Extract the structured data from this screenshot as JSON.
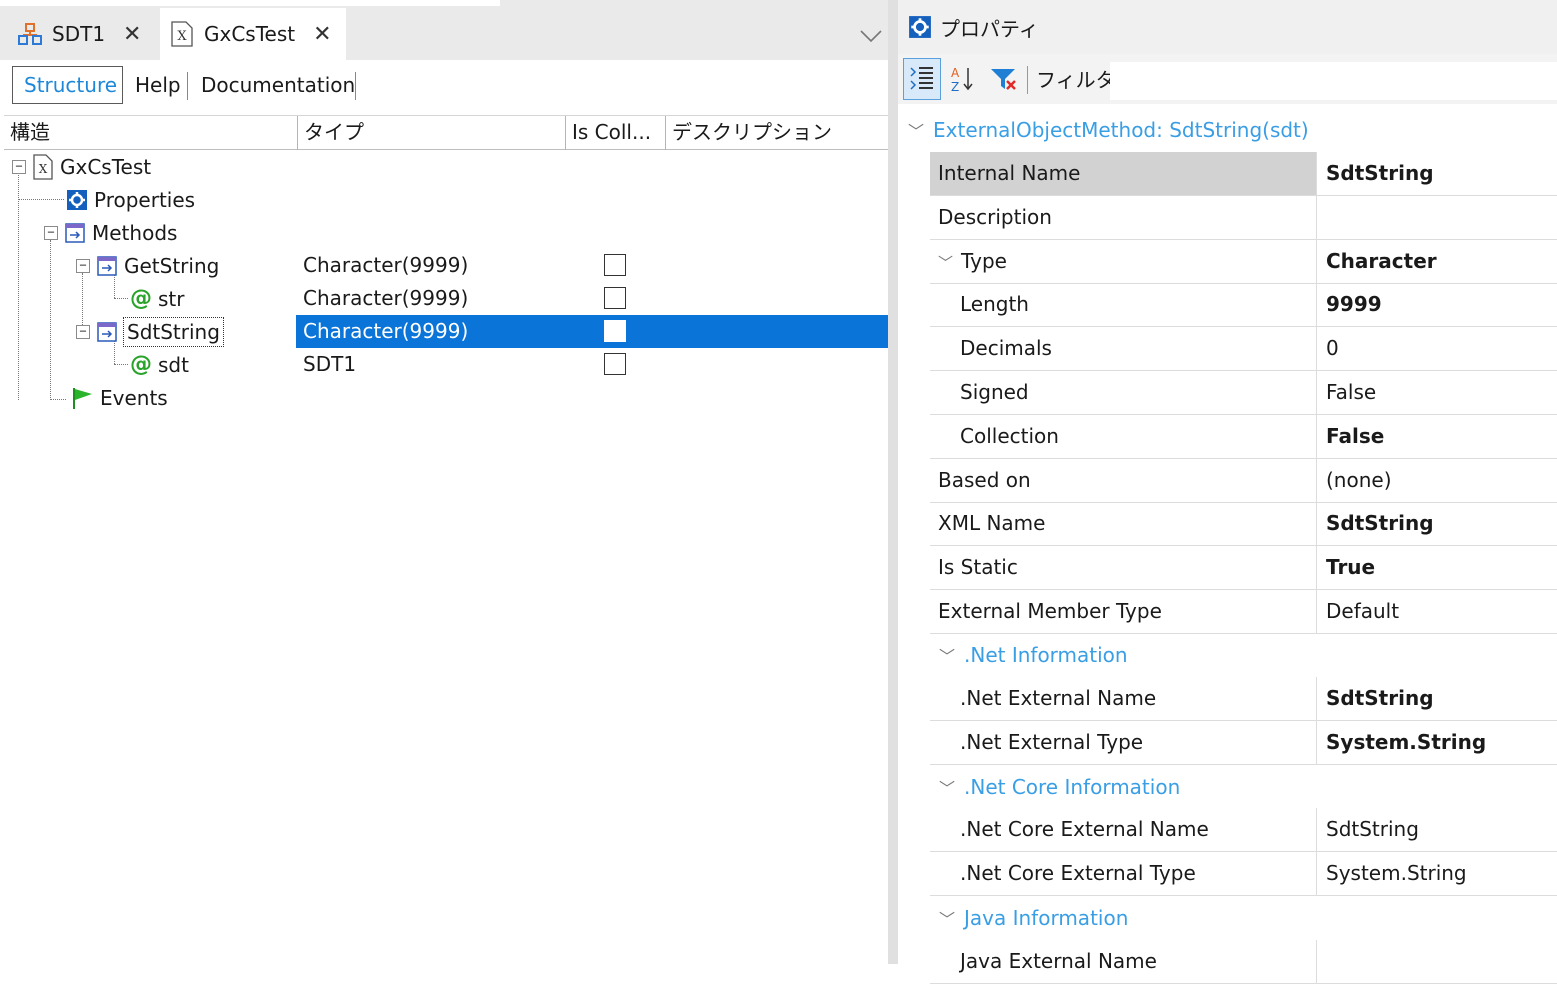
{
  "tabs": [
    {
      "label": "SDT1",
      "icon": "sdt-structure-icon"
    },
    {
      "label": "GxCsTest",
      "icon": "external-object-icon"
    }
  ],
  "subtabs": {
    "structure": "Structure",
    "help": "Help",
    "documentation": "Documentation"
  },
  "grid": {
    "headers": {
      "structure": "構造",
      "type": "タイプ",
      "is_collection": "Is Coll...",
      "description": "デスクリプション"
    },
    "rows": [
      {
        "name": "GxCsTest",
        "type": "",
        "level": 0
      },
      {
        "name": "Properties",
        "type": "",
        "level": 1
      },
      {
        "name": "Methods",
        "type": "",
        "level": 1
      },
      {
        "name": "GetString",
        "type": "Character(9999)",
        "level": 2,
        "is_collection": false
      },
      {
        "name": "str",
        "type": "Character(9999)",
        "level": 3,
        "is_collection": false
      },
      {
        "name": "SdtString",
        "type": "Character(9999)",
        "level": 2,
        "is_collection": false,
        "selected": true
      },
      {
        "name": "sdt",
        "type": "SDT1",
        "level": 3,
        "is_collection": false
      },
      {
        "name": "Events",
        "type": "",
        "level": 1
      }
    ]
  },
  "properties_panel": {
    "title": "プロパティ",
    "filter_label": "フィルタ",
    "object_header": "ExternalObjectMethod: SdtString(sdt)",
    "rows": [
      {
        "name": "Internal Name",
        "value": "SdtString",
        "bold": true,
        "selected": true
      },
      {
        "name": "Description",
        "value": ""
      },
      {
        "name": "Type",
        "value": "Character",
        "bold": true,
        "expandable": true
      },
      {
        "name": "Length",
        "value": "9999",
        "bold": true,
        "sub": true
      },
      {
        "name": "Decimals",
        "value": "0",
        "sub": true
      },
      {
        "name": "Signed",
        "value": "False",
        "sub": true
      },
      {
        "name": "Collection",
        "value": "False",
        "bold": true,
        "sub": true
      },
      {
        "name": "Based on",
        "value": "(none)"
      },
      {
        "name": "XML Name",
        "value": "SdtString",
        "bold": true
      },
      {
        "name": "Is Static",
        "value": "True",
        "bold": true
      },
      {
        "name": "External Member Type",
        "value": "Default"
      }
    ],
    "net_info": {
      "label": ".Net Information",
      "rows": [
        {
          "name": ".Net External Name",
          "value": "SdtString",
          "bold": true
        },
        {
          "name": ".Net External Type",
          "value": "System.String",
          "bold": true
        }
      ]
    },
    "netcore_info": {
      "label": ".Net Core Information",
      "rows": [
        {
          "name": ".Net Core External Name",
          "value": "SdtString"
        },
        {
          "name": ".Net Core External Type",
          "value": "System.String"
        }
      ]
    },
    "java_info": {
      "label": "Java Information",
      "rows": [
        {
          "name": "Java External Name",
          "value": ""
        }
      ]
    }
  }
}
